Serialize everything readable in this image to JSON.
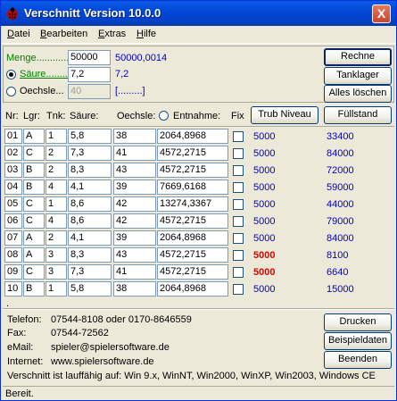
{
  "window": {
    "title": "Verschnitt Version 10.0.0",
    "close_glyph": "X"
  },
  "menu": [
    {
      "label": "Datei",
      "accel": "D",
      "rest": "atei"
    },
    {
      "label": "Bearbeiten",
      "accel": "B",
      "rest": "earbeiten"
    },
    {
      "label": "Extras",
      "accel": "E",
      "rest": "xtras"
    },
    {
      "label": "Hilfe",
      "accel": "H",
      "rest": "ilfe"
    }
  ],
  "inputs": {
    "menge_label": "Menge............",
    "menge_value": "50000",
    "menge_result": "50000,0014",
    "saeure_label": "Säure..........",
    "saeure_value": "7,2",
    "saeure_result": "7,2",
    "oechsle_label": "Oechsle...",
    "oechsle_value": "40",
    "oechsle_result": "[.........]"
  },
  "buttons": {
    "rechne": "Rechne",
    "tanklager": "Tanklager",
    "alles_loeschen": "Alles löschen",
    "trub_niveau": "Trub Niveau",
    "fuellstand": "Füllstand",
    "drucken": "Drucken",
    "beispieldaten": "Beispieldaten",
    "beenden": "Beenden"
  },
  "columns": {
    "nr": "Nr:",
    "lgr": "Lgr:",
    "tnk": "Tnk:",
    "saeure": "Säure:",
    "oechsle": "Oechsle:",
    "entnahme": "Entnahme:",
    "fix": "Fix"
  },
  "rows": [
    {
      "nr": "01",
      "lgr": "A",
      "tnk": "1",
      "saeure": "5,8",
      "oechsle": "38",
      "entnahme": "2064,8968",
      "cap": "5000",
      "result": "33400",
      "highlight": false
    },
    {
      "nr": "02",
      "lgr": "C",
      "tnk": "2",
      "saeure": "7,3",
      "oechsle": "41",
      "entnahme": "4572,2715",
      "cap": "5000",
      "result": "84000",
      "highlight": false
    },
    {
      "nr": "03",
      "lgr": "B",
      "tnk": "2",
      "saeure": "8,3",
      "oechsle": "43",
      "entnahme": "4572,2715",
      "cap": "5000",
      "result": "72000",
      "highlight": false
    },
    {
      "nr": "04",
      "lgr": "B",
      "tnk": "4",
      "saeure": "4,1",
      "oechsle": "39",
      "entnahme": "7669,6168",
      "cap": "5000",
      "result": "59000",
      "highlight": false
    },
    {
      "nr": "05",
      "lgr": "C",
      "tnk": "1",
      "saeure": "8,6",
      "oechsle": "42",
      "entnahme": "13274,3367",
      "cap": "5000",
      "result": "44000",
      "highlight": false
    },
    {
      "nr": "06",
      "lgr": "C",
      "tnk": "4",
      "saeure": "8,6",
      "oechsle": "42",
      "entnahme": "4572,2715",
      "cap": "5000",
      "result": "79000",
      "highlight": false
    },
    {
      "nr": "07",
      "lgr": "A",
      "tnk": "2",
      "saeure": "4,1",
      "oechsle": "39",
      "entnahme": "2064,8968",
      "cap": "5000",
      "result": "84000",
      "highlight": false
    },
    {
      "nr": "08",
      "lgr": "A",
      "tnk": "3",
      "saeure": "8,3",
      "oechsle": "43",
      "entnahme": "4572,2715",
      "cap": "5000",
      "result": "8100",
      "highlight": true
    },
    {
      "nr": "09",
      "lgr": "C",
      "tnk": "3",
      "saeure": "7,3",
      "oechsle": "41",
      "entnahme": "4572,2715",
      "cap": "5000",
      "result": "6640",
      "highlight": true
    },
    {
      "nr": "10",
      "lgr": "B",
      "tnk": "1",
      "saeure": "5,8",
      "oechsle": "38",
      "entnahme": "2064,8968",
      "cap": "5000",
      "result": "15000",
      "highlight": false
    }
  ],
  "separator_dot": ".",
  "info": {
    "telefon_label": "Telefon:",
    "telefon": "07544-8108 oder 0170-8646559",
    "fax_label": "Fax:",
    "fax": "07544-72562",
    "email_label": "eMail:",
    "email": "spieler@spielersoftware.de",
    "internet_label": "Internet:",
    "internet": "www.spielersoftware.de",
    "compat": "Verschnitt ist lauffähig auf: Win 9.x, WinNT, Win2000, WinXP, Win2003, Windows CE"
  },
  "status": "Bereit.",
  "colors": {
    "blue_value": "#0000c8",
    "red_value": "#e00000",
    "label_green": "#008000"
  },
  "icons": {
    "app": "ladybug-icon"
  }
}
